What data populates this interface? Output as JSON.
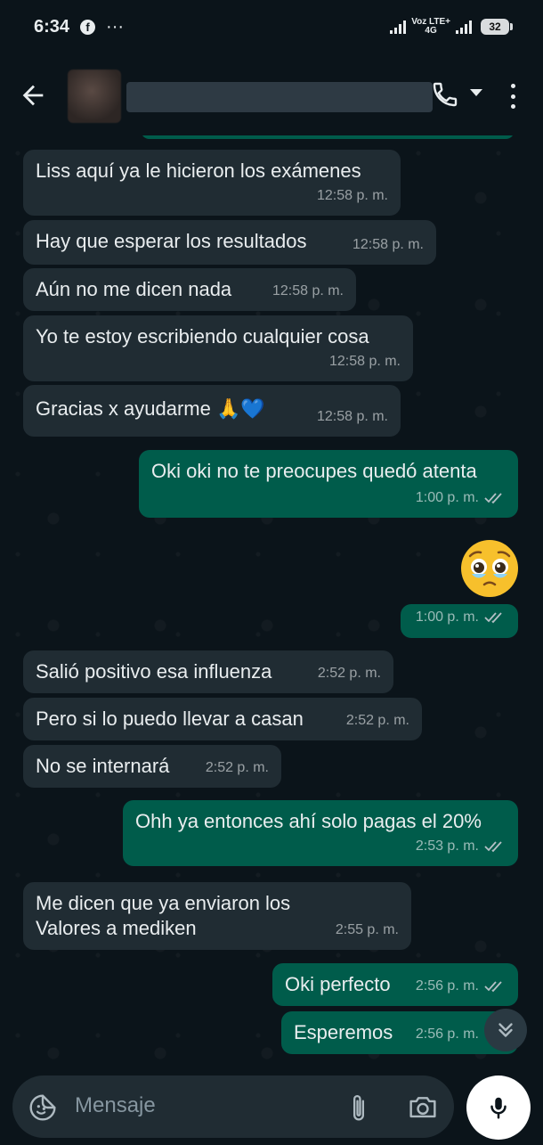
{
  "status": {
    "time": "6:34",
    "fb": "f",
    "dots": "···",
    "network_top": "Voz LTE+",
    "network_bottom": "4G",
    "battery": "32"
  },
  "header": {
    "back_icon": "arrow-left-icon",
    "call_icon": "phone-icon",
    "more_icon": "vertical-dots-icon"
  },
  "messages": [
    {
      "dir": "in",
      "text": "Liss aquí ya le hicieron los exámenes",
      "time": "12:58 p. m."
    },
    {
      "dir": "in",
      "text": "Hay que esperar los resultados",
      "time": "12:58 p. m."
    },
    {
      "dir": "in",
      "text": "Aún no me dicen nada",
      "time": "12:58 p. m."
    },
    {
      "dir": "in",
      "text": "Yo te estoy escribiendo cualquier cosa",
      "time": "12:58 p. m."
    },
    {
      "dir": "in",
      "text": "Gracias x ayudarme 🙏💙",
      "time": "12:58 p. m."
    },
    {
      "dir": "out",
      "text": "Oki oki no te preocupes quedó atenta",
      "time": "1:00 p. m."
    },
    {
      "dir": "out",
      "text": "🥹",
      "time": "1:00 p. m."
    },
    {
      "dir": "in",
      "text": "Salió positivo esa influenza",
      "time": "2:52 p. m."
    },
    {
      "dir": "in",
      "text": "Pero si lo puedo llevar a casan",
      "time": "2:52 p. m."
    },
    {
      "dir": "in",
      "text": "No se internará",
      "time": "2:52 p. m."
    },
    {
      "dir": "out",
      "text": "Ohh ya entonces ahí solo pagas el 20%",
      "time": "2:53 p. m."
    },
    {
      "dir": "in",
      "text": "Me dicen que ya enviaron los\nValores a mediken",
      "time": "2:55 p. m."
    },
    {
      "dir": "out",
      "text": "Oki perfecto",
      "time": "2:56 p. m."
    },
    {
      "dir": "out",
      "text": "Esperemos",
      "time": "2:56 p. m."
    }
  ],
  "composer": {
    "placeholder": "Mensaje",
    "sticker_icon": "sticker-icon",
    "attach_icon": "paperclip-icon",
    "camera_icon": "camera-icon",
    "mic_icon": "microphone-icon"
  },
  "colors": {
    "background": "#0b141a",
    "incoming": "#202c33",
    "outgoing": "#005c4b"
  }
}
